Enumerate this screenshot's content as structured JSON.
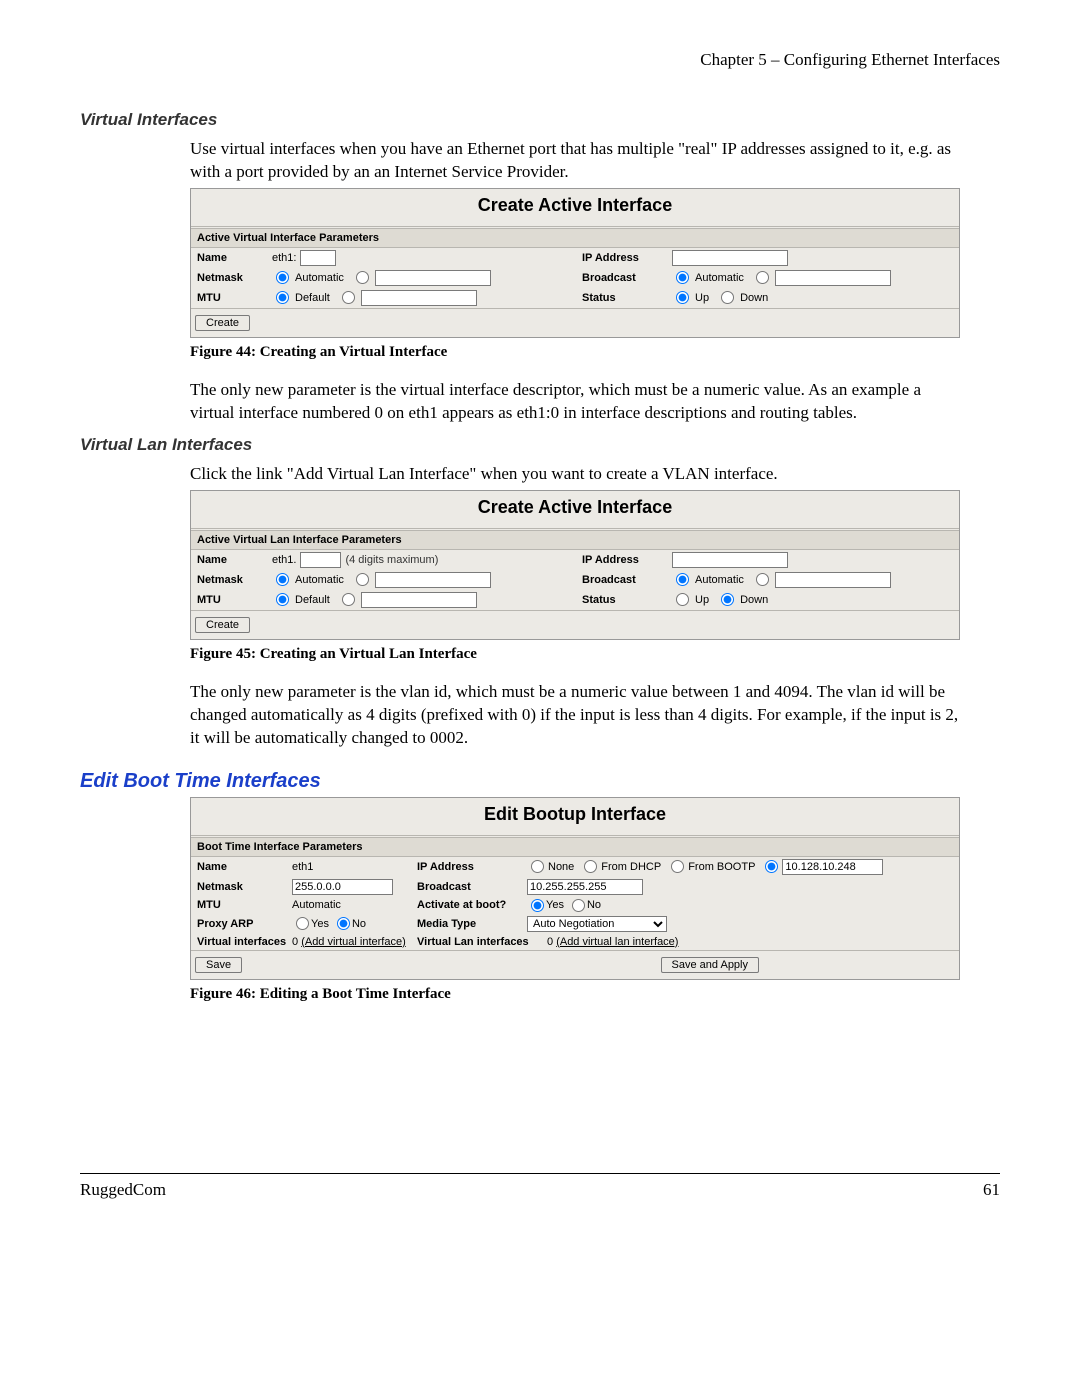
{
  "page": {
    "chapter": "Chapter 5 – Configuring Ethernet Interfaces",
    "footer_left": "RuggedCom",
    "footer_right": "61"
  },
  "s1": {
    "heading": "Virtual Interfaces",
    "p1": "Use virtual interfaces when you have an Ethernet port that has multiple \"real\" IP addresses assigned to it, e.g. as with a port provided by an an Internet Service Provider.",
    "fig": {
      "title": "Create Active Interface",
      "group": "Active Virtual Interface Parameters",
      "name_lbl": "Name",
      "name_val": "eth1:",
      "ip_lbl": "IP Address",
      "netmask_lbl": "Netmask",
      "automatic": "Automatic",
      "broadcast_lbl": "Broadcast",
      "mtu_lbl": "MTU",
      "default": "Default",
      "status_lbl": "Status",
      "up": "Up",
      "down": "Down",
      "create": "Create",
      "caption": "Figure 44: Creating an Virtual Interface"
    },
    "p2": "The only new parameter is the virtual interface descriptor, which must be a numeric value.  As an example a virtual interface numbered 0 on eth1 appears as eth1:0 in interface descriptions and routing tables."
  },
  "s2": {
    "heading": "Virtual Lan Interfaces",
    "p1": "Click the link \"Add Virtual Lan Interface\" when you want to create a VLAN interface.",
    "fig": {
      "title": "Create Active Interface",
      "group": "Active Virtual Lan Interface Parameters",
      "name_lbl": "Name",
      "name_val": "eth1.",
      "name_hint": "(4 digits maximum)",
      "ip_lbl": "IP Address",
      "netmask_lbl": "Netmask",
      "automatic": "Automatic",
      "broadcast_lbl": "Broadcast",
      "mtu_lbl": "MTU",
      "default": "Default",
      "status_lbl": "Status",
      "up": "Up",
      "down": "Down",
      "create": "Create",
      "caption": "Figure 45: Creating an Virtual Lan Interface"
    },
    "p2": "The only new parameter is the vlan id, which must be a numeric value between 1 and 4094. The vlan id will be changed automatically as 4 digits (prefixed with 0) if the input is less than 4 digits. For example, if the input is 2, it will be automatically changed to 0002."
  },
  "s3": {
    "heading": "Edit Boot Time Interfaces",
    "fig": {
      "title": "Edit Bootup Interface",
      "group": "Boot Time Interface Parameters",
      "name_lbl": "Name",
      "name_val": "eth1",
      "ip_lbl": "IP Address",
      "ip_none": "None",
      "ip_dhcp": "From DHCP",
      "ip_bootp": "From BOOTP",
      "ip_val": "10.128.10.248",
      "netmask_lbl": "Netmask",
      "netmask_val": "255.0.0.0",
      "broadcast_lbl": "Broadcast",
      "broadcast_val": "10.255.255.255",
      "mtu_lbl": "MTU",
      "mtu_val": "Automatic",
      "act_lbl": "Activate at boot?",
      "yes": "Yes",
      "no": "No",
      "proxy_lbl": "Proxy ARP",
      "media_lbl": "Media Type",
      "media_opt": "Auto Negotiation",
      "vint_lbl": "Virtual interfaces",
      "zero": "0",
      "vint_link": "(Add virtual interface)",
      "vlan_lbl": "Virtual Lan interfaces",
      "vlan_link": "(Add virtual lan interface)",
      "save": "Save",
      "saveapply": "Save and Apply",
      "caption": "Figure 46: Editing a Boot Time Interface"
    }
  }
}
